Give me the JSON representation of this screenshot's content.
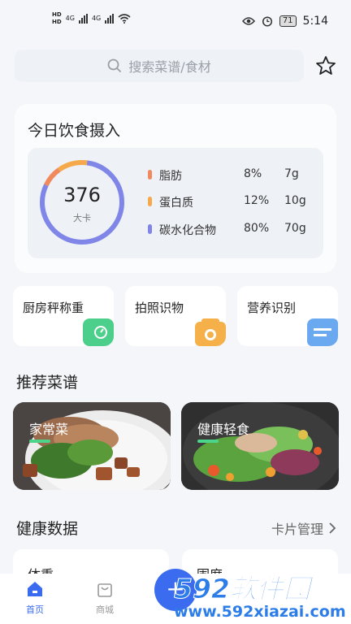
{
  "status_bar": {
    "hd1": "HD",
    "hd2": "HD",
    "signal1": "4G",
    "signal2": "4G",
    "battery": "71",
    "time": "5:14"
  },
  "search": {
    "placeholder": "搜索菜谱/食材"
  },
  "intake": {
    "title": "今日饮食摄入",
    "calories": "376",
    "unit": "大卡",
    "nutrients": [
      {
        "name": "脂肪",
        "percent": "8%",
        "grams": "7g",
        "color": "#f08a5d",
        "ring_fraction": 0.08
      },
      {
        "name": "蛋白质",
        "percent": "12%",
        "grams": "10g",
        "color": "#f5a94a",
        "ring_fraction": 0.12
      },
      {
        "name": "碳水化合物",
        "percent": "80%",
        "grams": "70g",
        "color": "#7f86e8",
        "ring_fraction": 0.8
      }
    ]
  },
  "functions": [
    {
      "label": "厨房秤称重",
      "icon": "scale-icon",
      "color": "#4ccf8a"
    },
    {
      "label": "拍照识物",
      "icon": "camera-icon",
      "color": "#f5b04a"
    },
    {
      "label": "营养识别",
      "icon": "document-icon",
      "color": "#6aa8f0"
    }
  ],
  "recipes_section": {
    "title": "推荐菜谱"
  },
  "recipes": [
    {
      "label": "家常菜"
    },
    {
      "label": "健康轻食"
    }
  ],
  "health_section": {
    "title": "健康数据",
    "manage": "卡片管理"
  },
  "health_cards": [
    {
      "label": "体重"
    },
    {
      "label": "围度"
    }
  ],
  "tabs": [
    {
      "label": "首页",
      "active": true
    },
    {
      "label": "商城",
      "active": false
    }
  ],
  "fab": {
    "label": "+"
  },
  "watermark": {
    "logo": "592软件园",
    "url": "www.592xiazai.com"
  },
  "colors": {
    "accent": "#3b6cf0",
    "recipe_bar": "#4ad58a"
  }
}
